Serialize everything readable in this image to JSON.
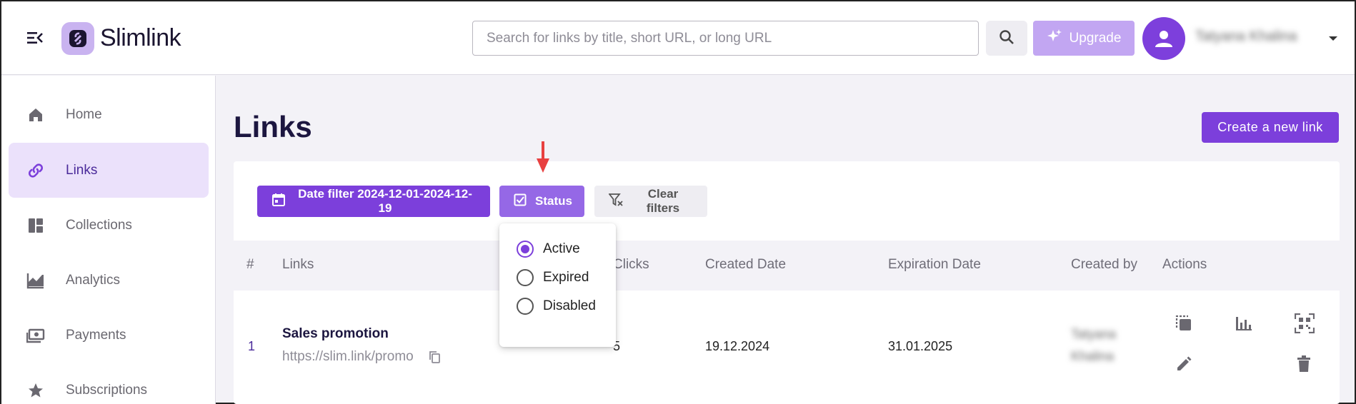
{
  "brand": {
    "name": "Slimlink",
    "accent": "#7c3fdb"
  },
  "header": {
    "search_placeholder": "Search for links by title, short URL, or long URL",
    "search_value": "",
    "upgrade_label": "Upgrade",
    "user_name": "Tatyana Khalina"
  },
  "sidebar": {
    "items": [
      {
        "label": "Home",
        "icon": "home-icon",
        "active": false
      },
      {
        "label": "Links",
        "icon": "link-icon",
        "active": true
      },
      {
        "label": "Collections",
        "icon": "collections-icon",
        "active": false
      },
      {
        "label": "Analytics",
        "icon": "analytics-icon",
        "active": false
      },
      {
        "label": "Payments",
        "icon": "payments-icon",
        "active": false
      },
      {
        "label": "Subscriptions",
        "icon": "star-icon",
        "active": false
      }
    ]
  },
  "main": {
    "title": "Links",
    "create_label": "Create a new link",
    "filters": {
      "date_label": "Date filter 2024-12-01-2024-12-19",
      "status_label": "Status",
      "clear_label": "Clear filters"
    },
    "status_options": [
      {
        "label": "Active",
        "checked": true
      },
      {
        "label": "Expired",
        "checked": false
      },
      {
        "label": "Disabled",
        "checked": false
      }
    ],
    "table": {
      "columns": [
        "#",
        "Links",
        "Clicks",
        "Created Date",
        "Expiration Date",
        "Created by",
        "Actions"
      ],
      "rows": [
        {
          "index": "1",
          "title": "Sales promotion",
          "url": "https://slim.link/promo",
          "clicks": "5",
          "created": "19.12.2024",
          "expires": "31.01.2025",
          "created_by_line1": "Tatyana",
          "created_by_line2": "Khalina"
        }
      ]
    }
  }
}
